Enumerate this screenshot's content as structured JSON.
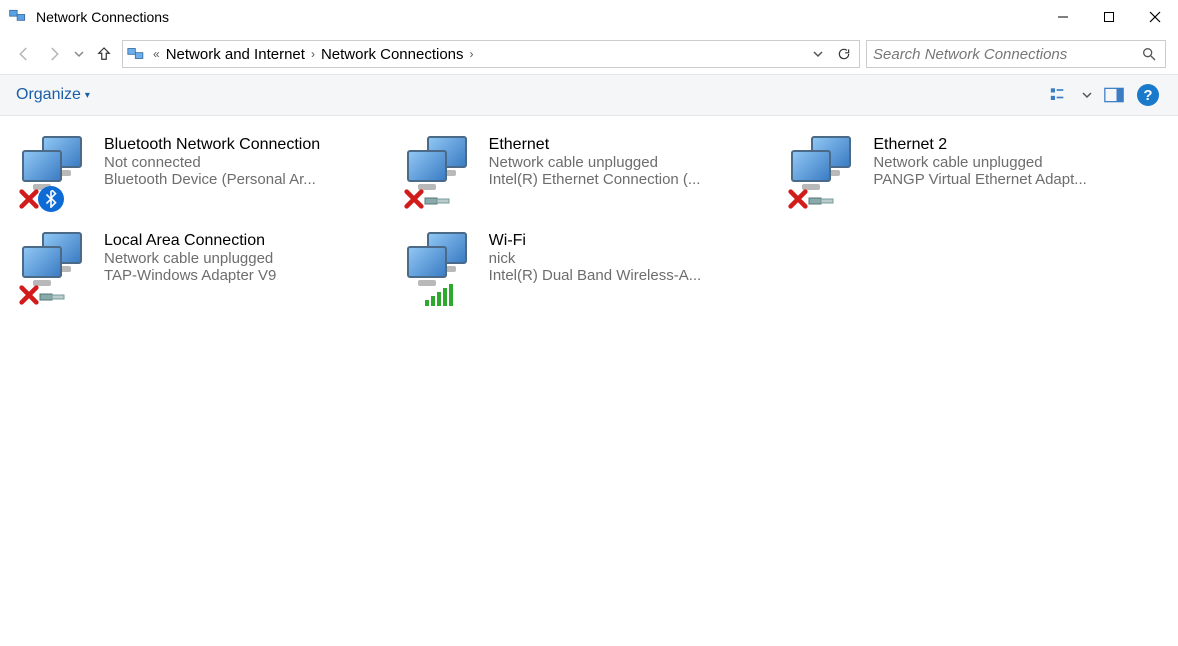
{
  "window": {
    "title": "Network Connections"
  },
  "breadcrumb": {
    "prefix": "«",
    "items": [
      "Network and Internet",
      "Network Connections"
    ]
  },
  "search": {
    "placeholder": "Search Network Connections"
  },
  "toolbar": {
    "organize_label": "Organize"
  },
  "connections": [
    {
      "name": "Bluetooth Network Connection",
      "status": "Not connected",
      "device": "Bluetooth Device (Personal Ar...",
      "overlay": "bluetooth_x"
    },
    {
      "name": "Ethernet",
      "status": "Network cable unplugged",
      "device": "Intel(R) Ethernet Connection (...",
      "overlay": "cable_x"
    },
    {
      "name": "Ethernet 2",
      "status": "Network cable unplugged",
      "device": "PANGP Virtual Ethernet Adapt...",
      "overlay": "cable_x"
    },
    {
      "name": "Local Area Connection",
      "status": "Network cable unplugged",
      "device": "TAP-Windows Adapter V9",
      "overlay": "cable_x"
    },
    {
      "name": "Wi-Fi",
      "status": "nick",
      "device": "Intel(R) Dual Band Wireless-A...",
      "overlay": "wifi"
    }
  ]
}
